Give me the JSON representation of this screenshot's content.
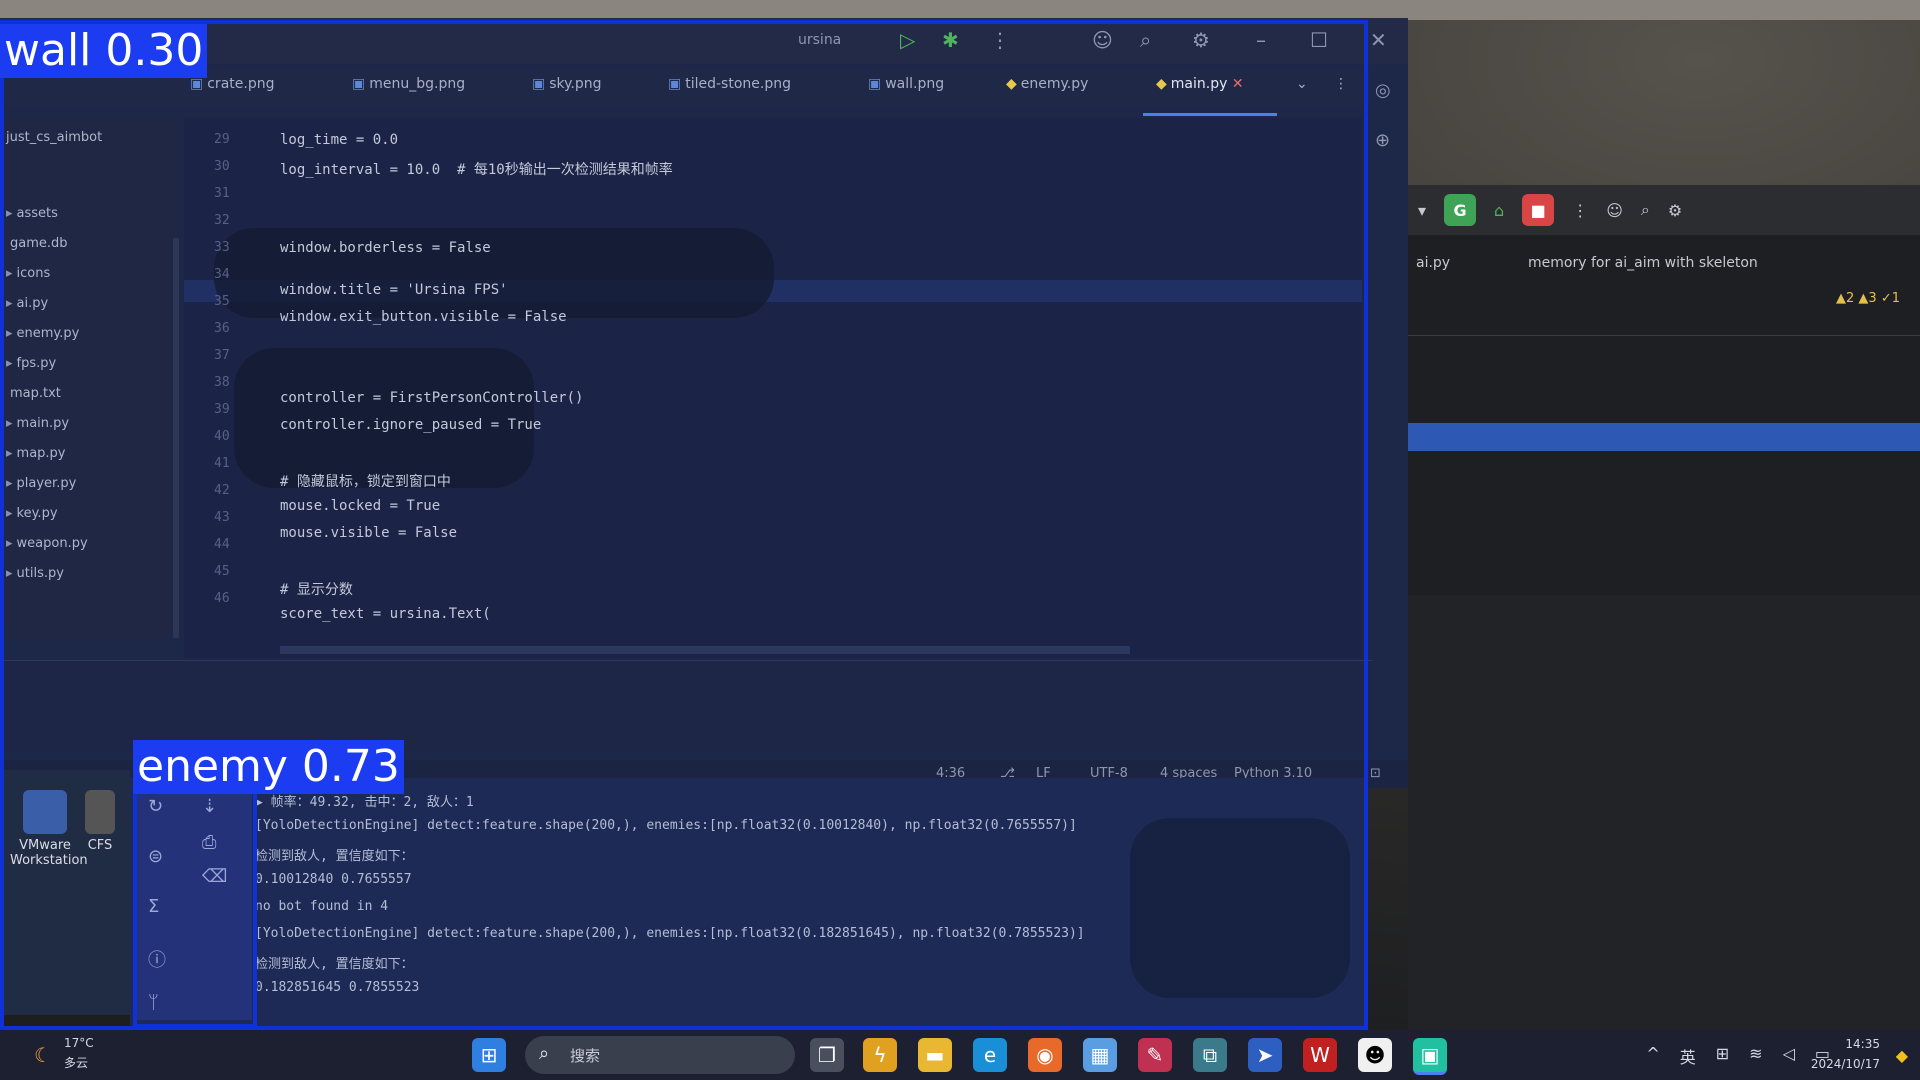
{
  "detections": [
    {
      "label": "wall 0.30"
    },
    {
      "label": "enemy 0.73"
    }
  ],
  "ide": {
    "title_run_config": "ursina",
    "tabs": [
      {
        "label": "crate.png",
        "icon": "image-icon"
      },
      {
        "label": "menu_bg.png",
        "icon": "image-icon"
      },
      {
        "label": "sky.png",
        "icon": "image-icon"
      },
      {
        "label": "tiled-stone.png",
        "icon": "image-icon"
      },
      {
        "label": "wall.png",
        "icon": "image-icon"
      },
      {
        "label": "enemy.py",
        "icon": "python-icon"
      },
      {
        "label": "main.py",
        "icon": "python-icon",
        "active": true
      }
    ],
    "project_root": "just_cs_aimbot",
    "tree_items": [
      "assets",
      "game.db",
      "icons",
      "ai.py",
      "enemy.py",
      "fps.py",
      "map.txt",
      "main.py",
      "map.py",
      "player.py",
      "key.py",
      "weapon.py",
      "utils.py"
    ],
    "line_numbers": [
      "29",
      "30",
      "31",
      "32",
      "33",
      "34",
      "35",
      "36",
      "37",
      "38",
      "39",
      "40",
      "41",
      "42",
      "43",
      "44",
      "45",
      "46"
    ],
    "code_lines": [
      "log_time = 0.0",
      "log_interval = 10.0  # 每10秒输出一次检测结果和帧率",
      "",
      "",
      "window.borderless = False",
      "window.title = 'Ursina FPS'",
      "window.exit_button.visible = False",
      "",
      "",
      "controller = FirstPersonController()",
      "controller.ignore_paused = True",
      "",
      "# 隐藏鼠标，锁定到窗口中",
      "mouse.locked = True",
      "mouse.visible = False",
      "",
      "# 显示分数",
      "score_text = ursina.Text("
    ],
    "statusbar": [
      "4:36",
      "LF",
      "UTF-8",
      "4 spaces",
      "Python 3.10"
    ]
  },
  "terminal": {
    "lines": [
      "▶ 帧率：49.32, 击中：2, 敌人：1",
      "[YoloDetectionEngine] detect:feature.shape(200,), enemies:[np.float32(0.10012840), np.float32(0.7655557)]",
      "检测到敌人, 置信度如下：",
      "0.10012840 0.7655557",
      "no bot found in 4",
      "[YoloDetectionEngine] detect:feature.shape(200,), enemies:[np.float32(0.182851645), np.float32(0.7855523)]",
      "检测到敌人, 置信度如下：",
      "0.182851645 0.7855523"
    ]
  },
  "ide2": {
    "tab1": "ai.py",
    "tab2": "memory for ai_aim with skeleton",
    "warnings": "▲2 ▲3 ✓1",
    "run_badge": "G",
    "stop_badge": "■"
  },
  "desktop": {
    "icons": [
      "VMware Workstation",
      "CFS"
    ]
  },
  "taskbar": {
    "weather_temp": "17°C",
    "weather_desc": "多云",
    "search_placeholder": "搜索",
    "lang": "英",
    "clock_time": "14:35",
    "clock_date": "2024/10/17"
  },
  "colors": {
    "detection_box": "#1030d8",
    "detection_label_bg": "#1b3cf0",
    "accent": "#4d7ff0"
  }
}
